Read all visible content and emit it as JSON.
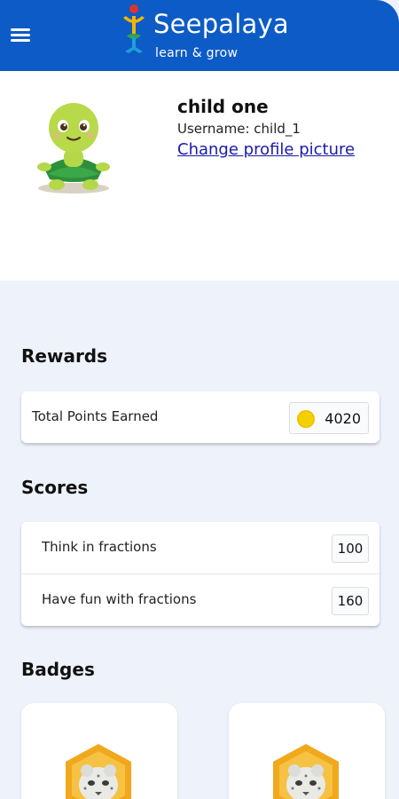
{
  "header": {
    "brand_name": "Seepalaya",
    "tagline": "learn & grow",
    "menu_icon": "hamburger-menu-icon",
    "colors": {
      "bar": "#0d5bc6"
    }
  },
  "profile": {
    "name": "child one",
    "username": "Username: child_1",
    "change_picture_link": "Change profile picture",
    "avatar": "turtle-avatar"
  },
  "rewards": {
    "title": "Rewards",
    "label": "Total Points Earned",
    "points": "4020",
    "icon": "coin-icon"
  },
  "scores": {
    "title": "Scores",
    "items": [
      {
        "label": "Think in fractions",
        "value": "100"
      },
      {
        "label": "Have fun with fractions",
        "value": "160"
      }
    ]
  },
  "badges": {
    "title": "Badges",
    "items": [
      {
        "icon": "snow-leopard-badge-icon"
      },
      {
        "icon": "snow-leopard-badge-icon"
      }
    ]
  }
}
